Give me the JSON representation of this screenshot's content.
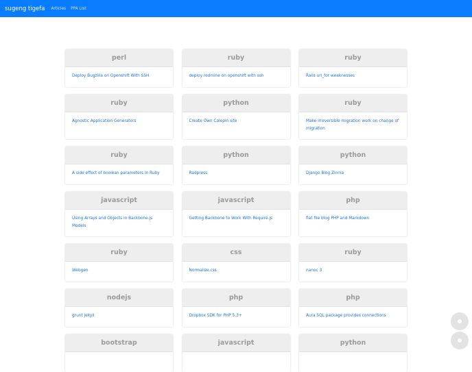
{
  "navbar": {
    "brand": "sugeng tigefa",
    "links": [
      "Articles",
      "PPA List"
    ]
  },
  "cards": [
    {
      "tag": "perl",
      "title": "Deploy Bugzilla on Openshift With SSH"
    },
    {
      "tag": "ruby",
      "title": "deploy redmine on openshift with ssh"
    },
    {
      "tag": "ruby",
      "title": "Rails url_for weaknesses"
    },
    {
      "tag": "ruby",
      "title": "Agnostic Application Generators"
    },
    {
      "tag": "python",
      "title": "Create Own Calepin site"
    },
    {
      "tag": "ruby",
      "title": "Make irreversible migration work on change of migration"
    },
    {
      "tag": "ruby",
      "title": "A side effect of boolean parameters in Ruby"
    },
    {
      "tag": "python",
      "title": "Radpress"
    },
    {
      "tag": "python",
      "title": "Django Blog Zinnia"
    },
    {
      "tag": "javascript",
      "title": "Using Arrays and Objects in Backbone.js Models"
    },
    {
      "tag": "javascript",
      "title": "Getting Backbone to Work With Require.js"
    },
    {
      "tag": "php",
      "title": "flat file blog PHP and Markdown"
    },
    {
      "tag": "ruby",
      "title": "Webgen"
    },
    {
      "tag": "css",
      "title": "Normalize.css"
    },
    {
      "tag": "ruby",
      "title": "nanoc 3"
    },
    {
      "tag": "nodejs",
      "title": "grunt jekyll"
    },
    {
      "tag": "php",
      "title": "Dropbox SDK for PHP 5.3+"
    },
    {
      "tag": "php",
      "title": "Aura SQL package provides connections"
    },
    {
      "tag": "bootstrap",
      "title": ""
    },
    {
      "tag": "javascript",
      "title": ""
    },
    {
      "tag": "python",
      "title": ""
    }
  ]
}
